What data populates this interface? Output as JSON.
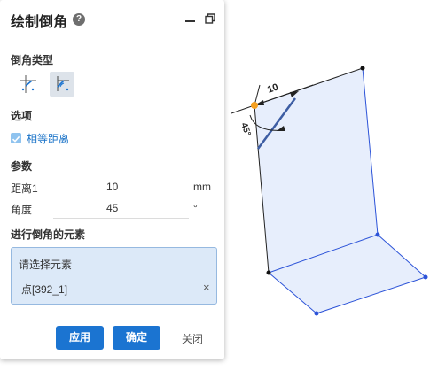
{
  "panel": {
    "title": "绘制倒角",
    "help_icon": "question-icon",
    "window_icons": [
      "minimize-icon",
      "restore-icon"
    ]
  },
  "chamfer_type": {
    "section_label": "倒角类型",
    "buttons": [
      {
        "icon": "chamfer-two-distance-icon",
        "active": false
      },
      {
        "icon": "chamfer-distance-angle-icon",
        "active": true
      }
    ]
  },
  "options": {
    "section_label": "选项",
    "equal_distance": {
      "label": "相等距离",
      "checked": true
    }
  },
  "params": {
    "section_label": "参数",
    "rows": [
      {
        "label": "距离1",
        "value": "10",
        "unit": "mm"
      },
      {
        "label": "角度",
        "value": "45",
        "unit": "°"
      }
    ]
  },
  "elements": {
    "section_label": "进行倒角的元素",
    "prompt": "请选择元素",
    "items": [
      {
        "label": "点[392_1]",
        "remove": "×"
      }
    ]
  },
  "actions": {
    "apply": "应用",
    "ok": "确定",
    "close": "关闭"
  },
  "viewport": {
    "dimension_label": "10",
    "angle_label": "45°",
    "colors": {
      "face_fill": "#e7eefc",
      "edge_blue": "#2c53d8",
      "selected_vertex": "#f5a020",
      "chamfer_preview": "#3d5da3"
    }
  }
}
